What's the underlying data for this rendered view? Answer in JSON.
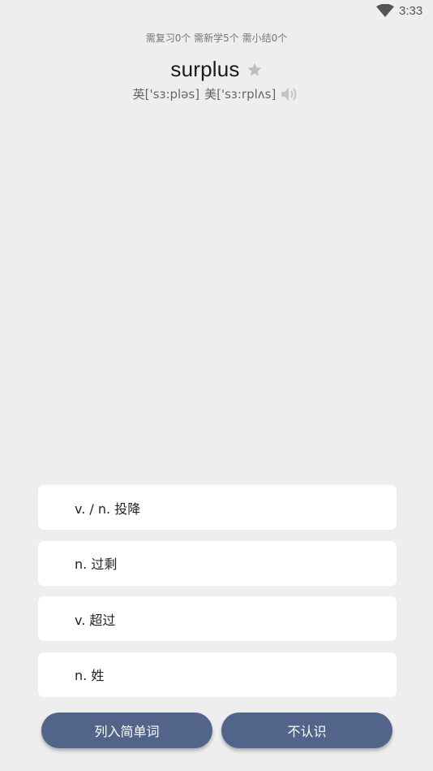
{
  "status_bar": {
    "time": "3:33",
    "wifi_icon": "wifi-icon"
  },
  "progress_text": "需复习0个 需新学5个 需小结0个",
  "word": {
    "text": "surplus",
    "star_icon": "star-icon",
    "phonetic_uk_label": "英",
    "phonetic_uk": "['sɜ:pləs]",
    "phonetic_us_label": "美",
    "phonetic_us": "['sɜ:rplʌs]",
    "speaker_icon": "speaker-icon"
  },
  "options": [
    {
      "label": "v. / n. 投降"
    },
    {
      "label": "n. 过剩"
    },
    {
      "label": "v. 超过"
    },
    {
      "label": "n. 姓"
    }
  ],
  "buttons": {
    "easy_label": "列入简单词",
    "unknown_label": "不认识"
  },
  "colors": {
    "background": "#eeeeee",
    "button": "#52648a",
    "star": "#bdbdbd"
  }
}
